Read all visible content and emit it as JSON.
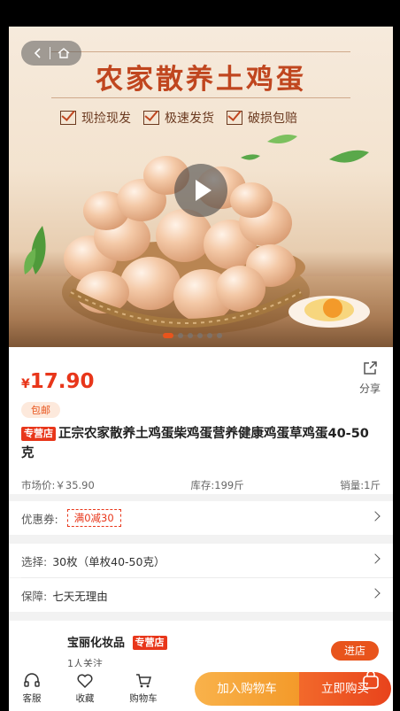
{
  "hero": {
    "title": "农家散养土鸡蛋",
    "features": [
      "现捡现发",
      "极速发货",
      "破损包赔"
    ],
    "slide_count": 6,
    "active_slide": 1
  },
  "product": {
    "currency": "¥",
    "price": "17.90",
    "share_label": "分享",
    "free_shipping": "包邮",
    "shop_tag": "专营店",
    "title": "正宗农家散养土鸡蛋柴鸡蛋营养健康鸡蛋草鸡蛋40-50克",
    "market_price": "市场价:￥35.90",
    "stock": "库存:199斤",
    "sales": "销量:1斤"
  },
  "coupon": {
    "label": "优惠券:",
    "value": "满0减30"
  },
  "options": {
    "select_label": "选择:",
    "select_value": "30枚（单枚40-50克）",
    "guarantee_label": "保障:",
    "guarantee_value": "七天无理由"
  },
  "shop": {
    "name": "宝丽化妆品",
    "tag": "专营店",
    "followers": "1人关注",
    "enter_label": "进店"
  },
  "bottom_bar": {
    "service": "客服",
    "favorite": "收藏",
    "cart": "购物车",
    "add_to_cart": "加入购物车",
    "buy_now": "立即购买"
  },
  "colors": {
    "accent": "#e8361a",
    "orange": "#f39a2a"
  }
}
